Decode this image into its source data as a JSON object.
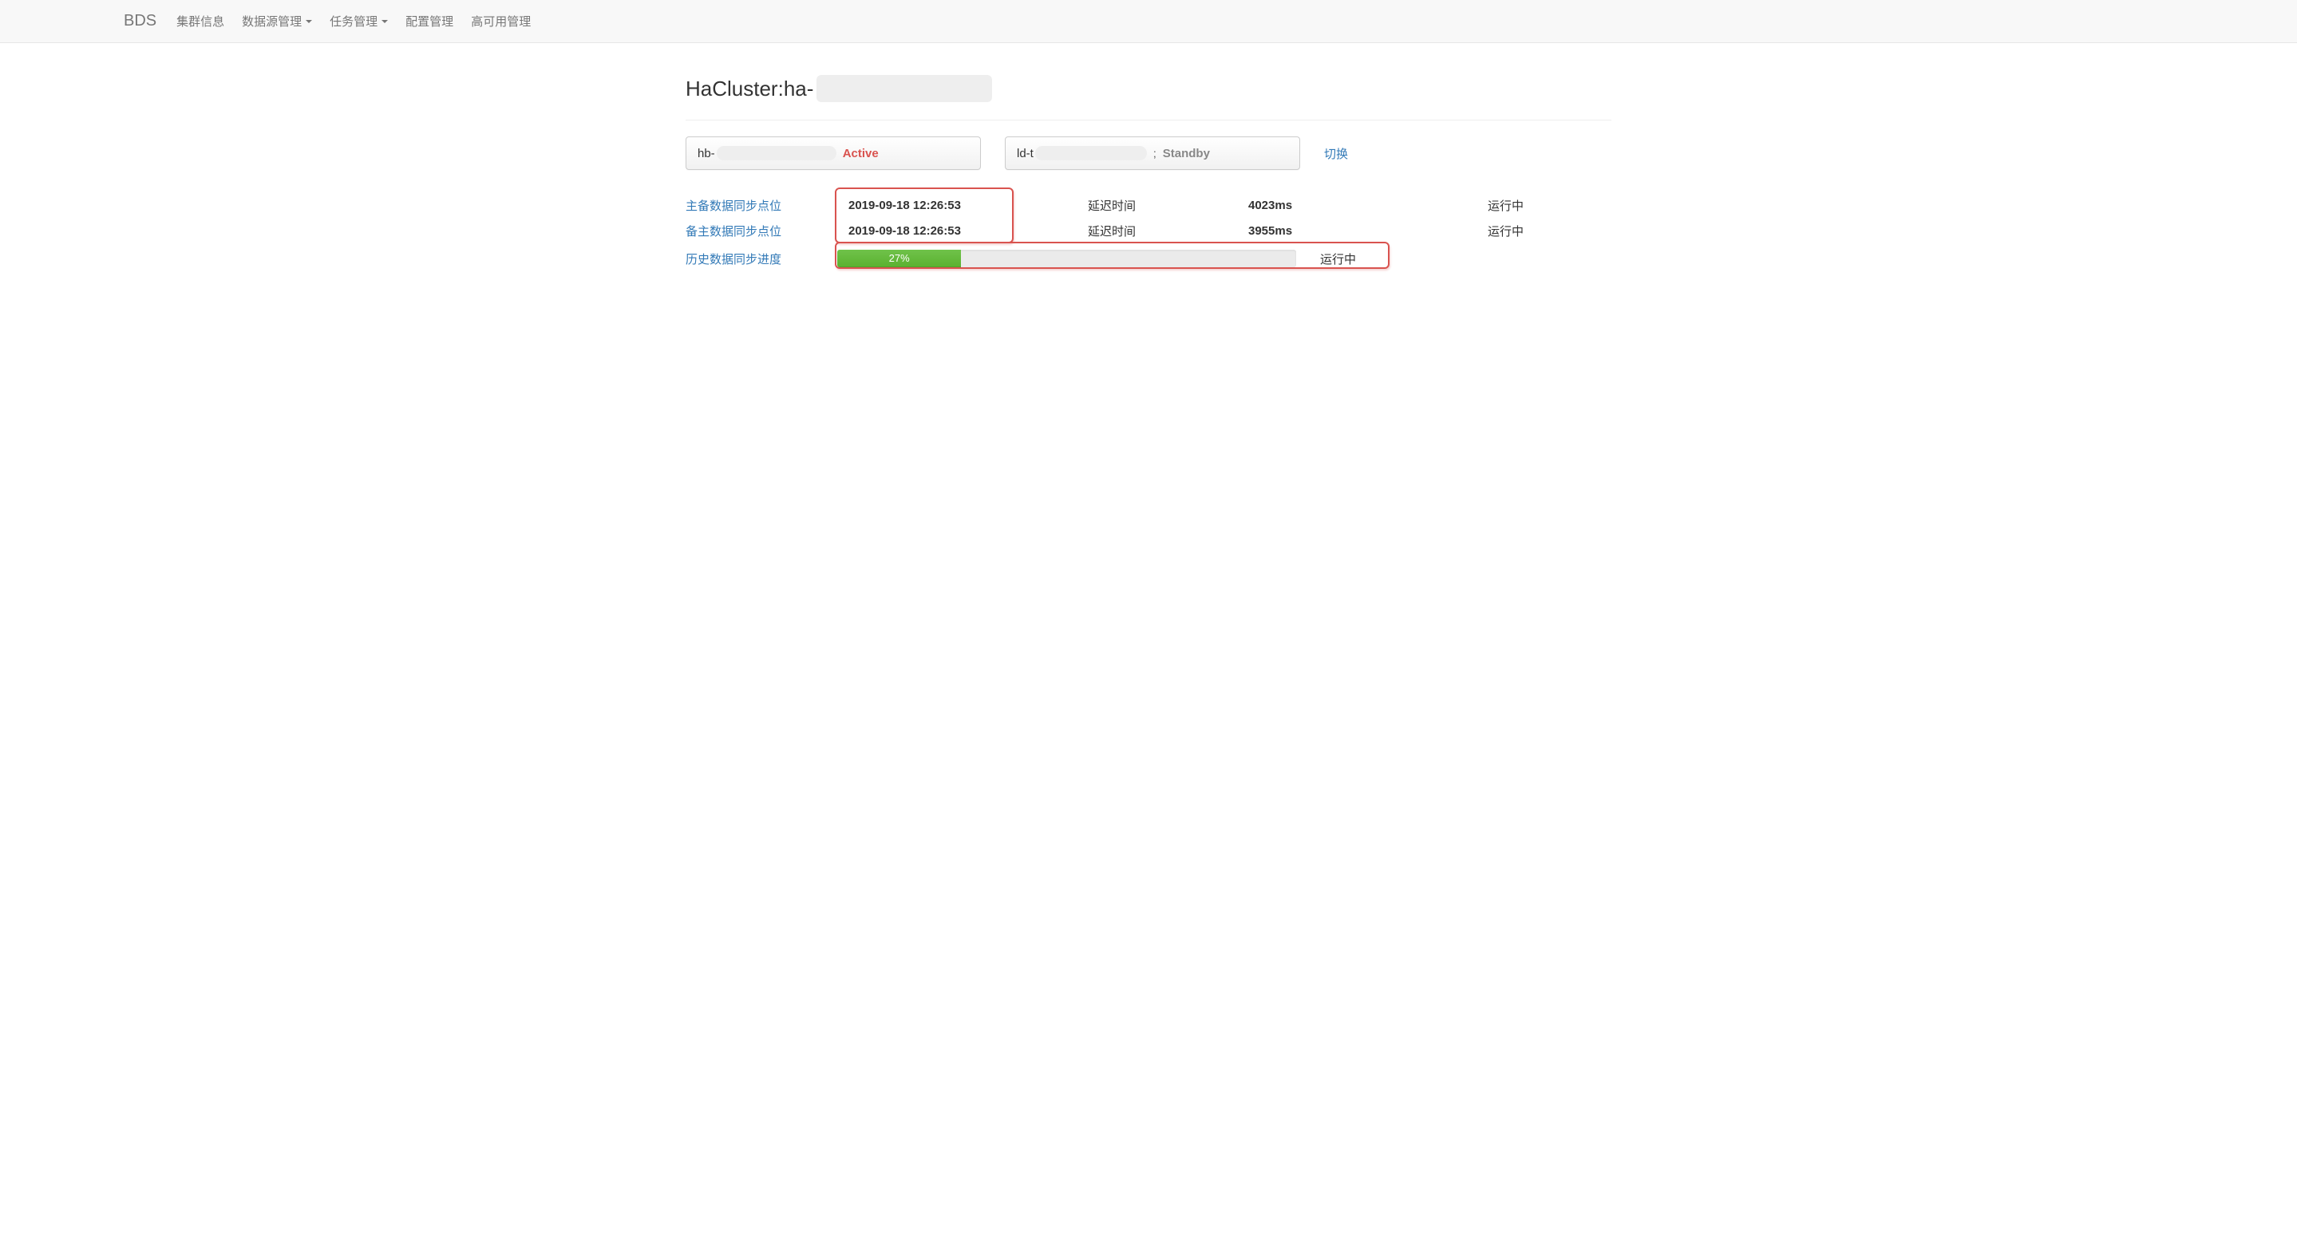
{
  "nav": {
    "brand": "BDS",
    "items": [
      {
        "label": "集群信息",
        "dropdown": false
      },
      {
        "label": "数据源管理",
        "dropdown": true
      },
      {
        "label": "任务管理",
        "dropdown": true
      },
      {
        "label": "配置管理",
        "dropdown": false
      },
      {
        "label": "高可用管理",
        "dropdown": false
      }
    ]
  },
  "page": {
    "title_prefix": "HaCluster:ha-"
  },
  "clusters": {
    "active": {
      "prefix": "hb-",
      "status": "Active"
    },
    "standby": {
      "prefix": "ld-t",
      "semi": ";",
      "status": "Standby"
    },
    "switch_label": "切换"
  },
  "sync": {
    "rows": [
      {
        "label": "主备数据同步点位",
        "timestamp": "2019-09-18 12:26:53",
        "delay_label": "延迟时间",
        "delay_value": "4023ms",
        "status": "运行中"
      },
      {
        "label": "备主数据同步点位",
        "timestamp": "2019-09-18 12:26:53",
        "delay_label": "延迟时间",
        "delay_value": "3955ms",
        "status": "运行中"
      }
    ],
    "progress": {
      "label": "历史数据同步进度",
      "percent_text": "27%",
      "percent_value": 27,
      "status": "运行中"
    }
  }
}
